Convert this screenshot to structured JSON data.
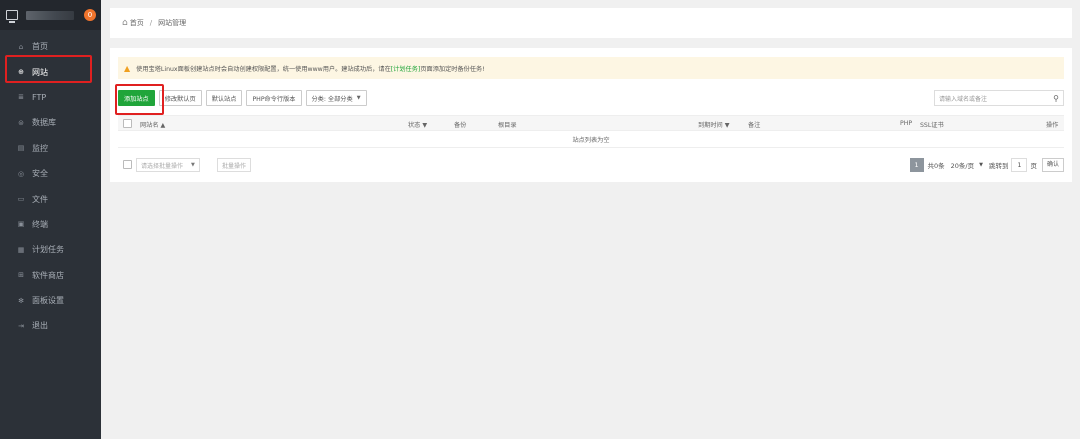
{
  "sidebar": {
    "badge": "0",
    "items": [
      {
        "icon": "home-icon",
        "glyph": "⌂",
        "label": "首页"
      },
      {
        "icon": "globe-icon",
        "glyph": "⊕",
        "label": "网站"
      },
      {
        "icon": "server-icon",
        "glyph": "≣",
        "label": "FTP"
      },
      {
        "icon": "database-icon",
        "glyph": "⊜",
        "label": "数据库"
      },
      {
        "icon": "monitor-icon",
        "glyph": "▤",
        "label": "监控"
      },
      {
        "icon": "shield-icon",
        "glyph": "◎",
        "label": "安全"
      },
      {
        "icon": "folder-icon",
        "glyph": "▭",
        "label": "文件"
      },
      {
        "icon": "terminal-icon",
        "glyph": "▣",
        "label": "终端"
      },
      {
        "icon": "calendar-icon",
        "glyph": "▦",
        "label": "计划任务"
      },
      {
        "icon": "apps-icon",
        "glyph": "⊞",
        "label": "软件商店"
      },
      {
        "icon": "settings-icon",
        "glyph": "✻",
        "label": "面板设置"
      },
      {
        "icon": "logout-icon",
        "glyph": "⇥",
        "label": "退出"
      }
    ]
  },
  "breadcrumb": {
    "home": "首页",
    "separator": "/",
    "current": "网站管理"
  },
  "notice": {
    "before": "使用宝塔Linux面板创建站点时会自动创建权限配置，统一使用www用户。建站成功后，请在",
    "link": "[计划任务]",
    "after": "页面添加定时备份任务!"
  },
  "toolbar": {
    "add": "添加站点",
    "edit_default_page": "修改默认页",
    "default_site": "默认站点",
    "php_cli": "PHP命令行版本",
    "category": "分类: 全部分类"
  },
  "search": {
    "placeholder": "请输入域名或备注"
  },
  "table": {
    "headers": {
      "name": "网站名 ▲",
      "status": "状态 ▼",
      "backup": "备份",
      "root": "根目录",
      "expire": "到期时间 ▼",
      "remark": "备注",
      "php": "PHP",
      "ssl": "SSL证书",
      "action": "操作"
    },
    "empty": "站点列表为空"
  },
  "footer": {
    "batch_select": "请选择批量操作",
    "batch_button": "批量操作",
    "page_current": "1",
    "total": "共0条",
    "page_size": "20条/页",
    "goto": "跳转到",
    "goto_page": "1",
    "page_unit": "页",
    "confirm": "确认"
  },
  "colors": {
    "sidebar": "#2c3138",
    "accent": "#20a53a",
    "highlight": "#e02020",
    "badge": "#f0742c"
  }
}
